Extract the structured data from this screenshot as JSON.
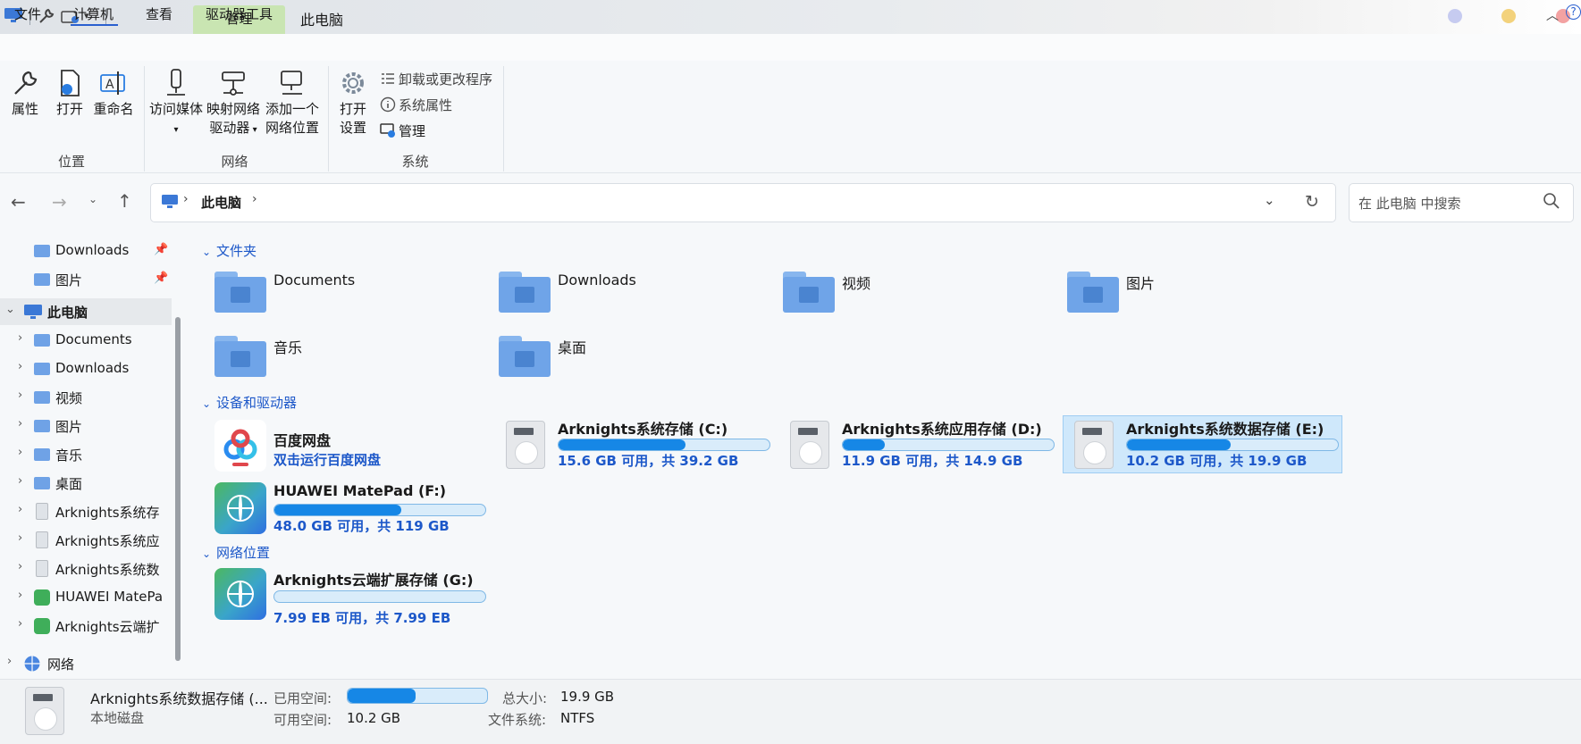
{
  "titlebar": {
    "context_tab": "管理",
    "title": "此电脑"
  },
  "menu": {
    "file": "文件",
    "computer": "计算机",
    "view": "查看",
    "drive_tools": "驱动器工具"
  },
  "ribbon": {
    "location": {
      "group": "位置",
      "properties": "属性",
      "open": "打开",
      "rename": "重命名"
    },
    "network": {
      "group": "网络",
      "access_media": "访问媒体",
      "map_drive_l1": "映射网络",
      "map_drive_l2": "驱动器",
      "add_location_l1": "添加一个",
      "add_location_l2": "网络位置"
    },
    "system": {
      "group": "系统",
      "open_settings_l1": "打开",
      "open_settings_l2": "设置",
      "uninstall": "卸载或更改程序",
      "system_props": "系统属性",
      "manage": "管理"
    }
  },
  "address": {
    "location": "此电脑",
    "search_placeholder": "在 此电脑 中搜索"
  },
  "sidebar": {
    "quick": [
      {
        "label": "Downloads"
      },
      {
        "label": "图片"
      }
    ],
    "this_pc": "此电脑",
    "items": [
      {
        "label": "Documents",
        "kind": "folder"
      },
      {
        "label": "Downloads",
        "kind": "folder"
      },
      {
        "label": "视频",
        "kind": "folder"
      },
      {
        "label": "图片",
        "kind": "folder"
      },
      {
        "label": "音乐",
        "kind": "folder"
      },
      {
        "label": "桌面",
        "kind": "folder"
      },
      {
        "label": "Arknights系统存",
        "kind": "drive"
      },
      {
        "label": "Arknights系统应",
        "kind": "drive"
      },
      {
        "label": "Arknights系统数",
        "kind": "drive"
      },
      {
        "label": "HUAWEI MatePa",
        "kind": "net"
      },
      {
        "label": "Arknights云端扩",
        "kind": "net"
      }
    ],
    "network": "网络"
  },
  "content": {
    "folders_header": "文件夹",
    "folders": [
      "Documents",
      "Downloads",
      "视频",
      "图片",
      "音乐",
      "桌面"
    ],
    "devices_header": "设备和驱动器",
    "baidu": {
      "name": "百度网盘",
      "sub": "双击运行百度网盘"
    },
    "drives": [
      {
        "name": "Arknights系统存储 (C:)",
        "info": "15.6 GB 可用，共 39.2 GB",
        "used": 0.6
      },
      {
        "name": "Arknights系统应用存储 (D:)",
        "info": "11.9 GB 可用，共 14.9 GB",
        "used": 0.2
      },
      {
        "name": "Arknights系统数据存储 (E:)",
        "info": "10.2 GB 可用，共 19.9 GB",
        "used": 0.49
      },
      {
        "name": "HUAWEI MatePad (F:)",
        "info": "48.0 GB 可用，共 119 GB",
        "used": 0.6
      }
    ],
    "netloc_header": "网络位置",
    "netloc": {
      "name": "Arknights云端扩展存储 (G:)",
      "info": "7.99 EB 可用，共 7.99 EB",
      "used": 0.0
    }
  },
  "status": {
    "name": "Arknights系统数据存储 (...",
    "type": "本地磁盘",
    "used_label": "已用空间:",
    "free_label": "可用空间:",
    "free_value": "10.2 GB",
    "total_label": "总大小:",
    "total_value": "19.9 GB",
    "fs_label": "文件系统:",
    "fs_value": "NTFS",
    "used": 0.49
  },
  "colors": {
    "accent": "#1d58c9",
    "bar_fill": "#1687e6",
    "folder": "#6fa4e8",
    "context_tab": "#c9e5b2"
  }
}
